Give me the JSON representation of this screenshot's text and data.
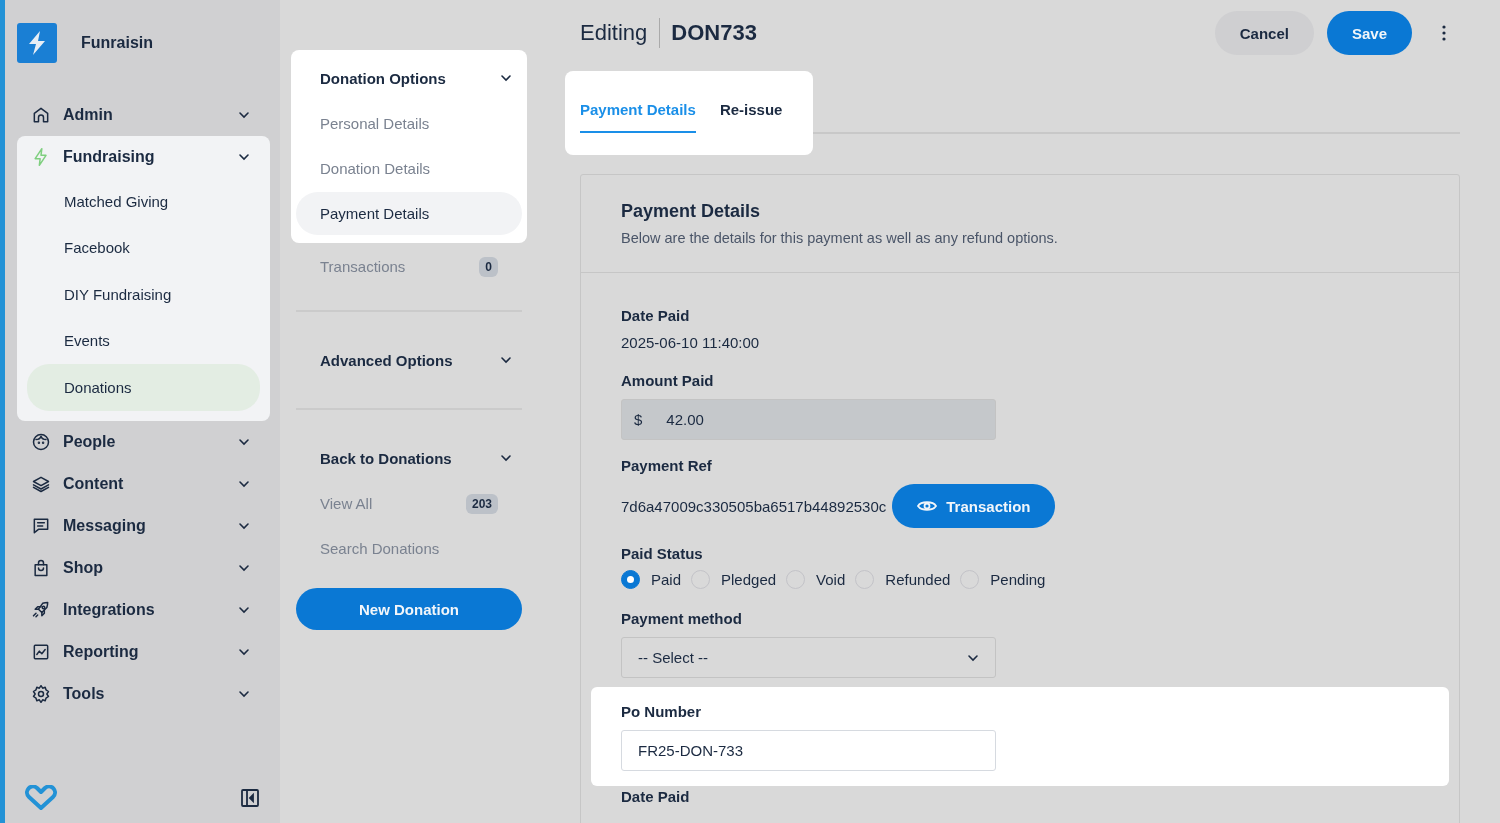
{
  "brand": {
    "name": "Funraisin"
  },
  "sidebar": {
    "items": [
      {
        "label": "Admin"
      },
      {
        "label": "Fundraising",
        "spotlight": true,
        "children": [
          {
            "label": "Matched Giving",
            "selected": false
          },
          {
            "label": "Facebook",
            "selected": false
          },
          {
            "label": "DIY Fundraising",
            "selected": false
          },
          {
            "label": "Events",
            "selected": false
          },
          {
            "label": "Donations",
            "selected": true
          }
        ]
      },
      {
        "label": "People"
      },
      {
        "label": "Content"
      },
      {
        "label": "Messaging"
      },
      {
        "label": "Shop"
      },
      {
        "label": "Integrations"
      },
      {
        "label": "Reporting"
      },
      {
        "label": "Tools"
      }
    ]
  },
  "subnav": {
    "sections": [
      {
        "title": "Donation Options",
        "spotlight": true,
        "items": [
          {
            "label": "Personal Details",
            "selected": false
          },
          {
            "label": "Donation Details",
            "selected": false
          },
          {
            "label": "Payment Details",
            "selected": true
          }
        ],
        "after": [
          {
            "label": "Transactions",
            "selected": false,
            "count": "0"
          }
        ]
      },
      {
        "title": "Advanced Options"
      },
      {
        "title": "Back to Donations",
        "items": [
          {
            "label": "View All",
            "selected": false,
            "count": "203"
          },
          {
            "label": "Search Donations",
            "selected": false
          }
        ]
      }
    ],
    "new_button": "New Donation"
  },
  "header": {
    "prefix": "Editing",
    "title": "DON733",
    "cancel": "Cancel",
    "save": "Save"
  },
  "tabs": {
    "spotlight": true,
    "items": [
      {
        "label": "Payment Details",
        "selected": true
      },
      {
        "label": "Re-issue",
        "selected": false
      }
    ]
  },
  "card": {
    "title": "Payment Details",
    "description": "Below are the details for this payment as well as any refund options.",
    "fields": [
      {
        "kind": "text",
        "label": "Date Paid",
        "value": "2025-06-10 11:40:00"
      },
      {
        "kind": "money",
        "label": "Amount Paid",
        "currency": "$",
        "value": "42.00",
        "disabled": true
      },
      {
        "kind": "ref",
        "label": "Payment Ref",
        "value": "7d6a47009c330505ba6517b44892530c",
        "button": "Transaction"
      },
      {
        "kind": "radio",
        "label": "Paid Status",
        "options": [
          {
            "label": "Paid",
            "selected": true
          },
          {
            "label": "Pledged",
            "selected": false
          },
          {
            "label": "Void",
            "selected": false
          },
          {
            "label": "Refunded",
            "selected": false
          },
          {
            "label": "Pending",
            "selected": false
          }
        ]
      },
      {
        "kind": "select",
        "label": "Payment method",
        "value": "-- Select --"
      },
      {
        "kind": "input",
        "label": "Po Number",
        "value": "FR25-DON-733",
        "spotlight": true
      },
      {
        "kind": "label",
        "label": "Date Paid"
      }
    ]
  }
}
